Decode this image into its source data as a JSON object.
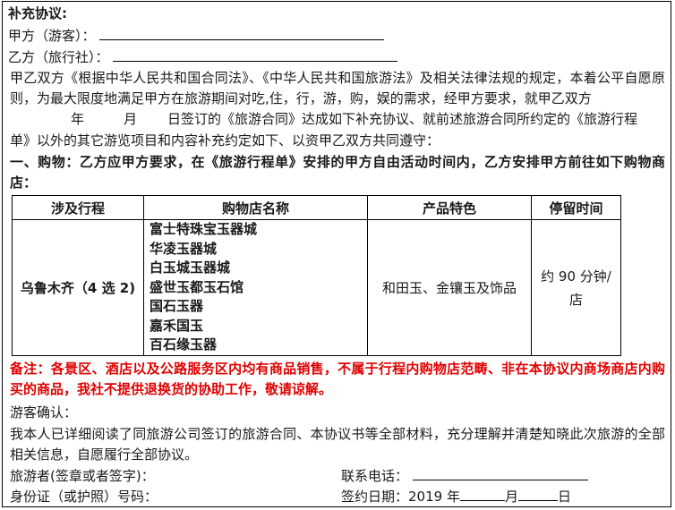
{
  "title": "补充协议:",
  "party_a_label": "甲方（游客）：",
  "party_b_label": "乙方（旅行社）：",
  "intro": "甲乙双方《根据中华人民共和国合同法》、《中华人民共和国旅游法》及相关法律法规的规定，本着公平自愿原则，为最大限度地满足甲方在旅游期间对吃,住，行，游，购，娱的需求，经甲方要求，就甲乙双方",
  "date_line": {
    "year": "年",
    "month": "月",
    "day": "日签订的《旅游合同》达成如下补充协议、就前述旅游合同所约定的《旅游行程"
  },
  "intro_end": "单》以外的其它游览项目和内容补充约定如下、以资甲乙双方共同遵守：",
  "section1": "一、购物：乙方应甲方要求，在《旅游行程单》安排的甲方自由活动时间内，乙方安排甲方前往如下购物商店：",
  "table": {
    "headers": [
      "涉及行程",
      "购物店名称",
      "产品特色",
      "停留时间"
    ],
    "row": {
      "route": "乌鲁木齐（4 选 2)",
      "stores": [
        "富士特珠宝玉器城",
        "华凌玉器城",
        "白玉城玉器城",
        "盛世玉都玉石馆",
        "国石玉器",
        "嘉禾国玉",
        "百石缘玉器"
      ],
      "features": "和田玉、金镶玉及饰品",
      "stay_line1": "约 90 分钟/",
      "stay_line2": "店"
    }
  },
  "remark": "备注：各景区、酒店以及公路服务区内均有商品销售，不属于行程内购物店范畴、非在本协议内商场商店内购买的商品，我社不提供退换货的协助工作，敬请谅解。",
  "confirm_title": "游客确认：",
  "confirm_text": "我本人已详细阅读了同旅游公司签订的旅游合同、本协议书等全部材料，充分理解并清楚知晓此次旅游的全部相关信息，自愿履行全部协议。",
  "tourist_sign_label": "旅游者(签章或者签字)：",
  "phone_label": "联系电话：",
  "id_label": "身份证（或护照）号码：",
  "sign_date": {
    "label": "签约日期：2019 年",
    "month": "月",
    "day": "日"
  }
}
